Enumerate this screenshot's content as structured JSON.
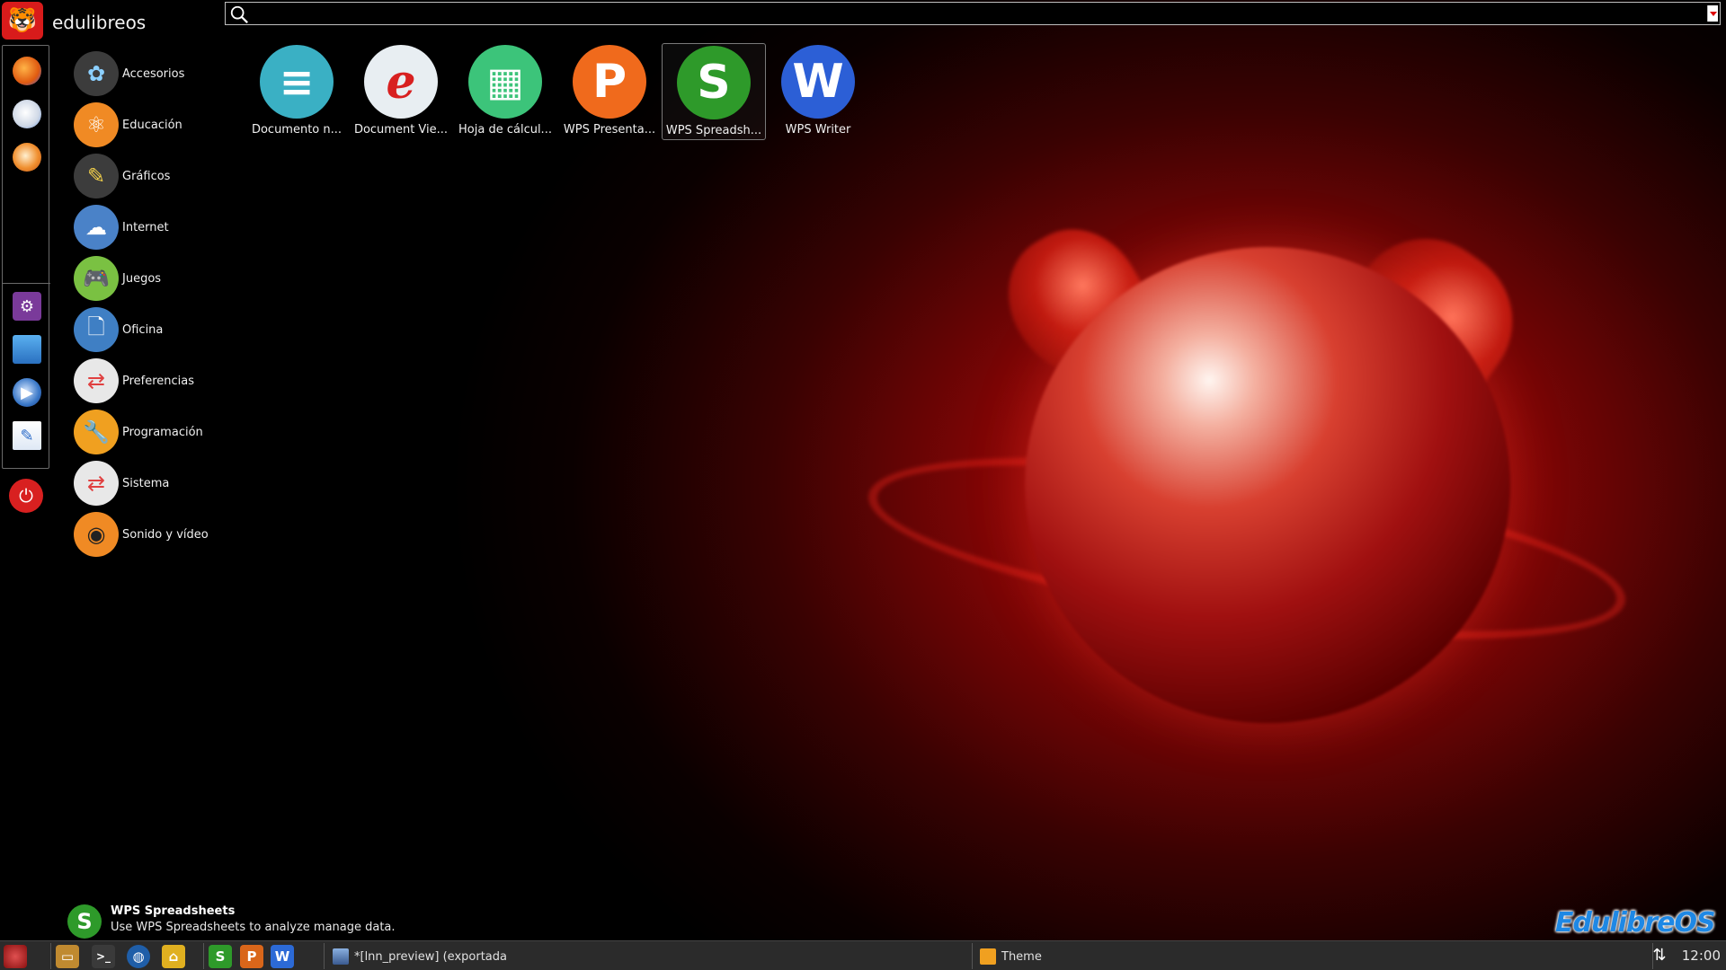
{
  "header": {
    "title": "edulibreos"
  },
  "search": {
    "value": "",
    "placeholder": ""
  },
  "categories": [
    {
      "label": "Accesorios",
      "icon": "accessories-icon",
      "color": "#3c3c3c"
    },
    {
      "label": "Educación",
      "icon": "education-atom-icon",
      "color": "#f08a24"
    },
    {
      "label": "Gráficos",
      "icon": "graphics-icon",
      "color": "#3c3c3c"
    },
    {
      "label": "Internet",
      "icon": "internet-cloud-icon",
      "color": "#4a82c8"
    },
    {
      "label": "Juegos",
      "icon": "games-controller-icon",
      "color": "#7ac142"
    },
    {
      "label": "Oficina",
      "icon": "office-document-icon",
      "color": "#3f7fc4"
    },
    {
      "label": "Preferencias",
      "icon": "preferences-toggle-icon",
      "color": "#e8e8e8"
    },
    {
      "label": "Programación",
      "icon": "programming-wrench-icon",
      "color": "#f0a020"
    },
    {
      "label": "Sistema",
      "icon": "system-toggle-icon",
      "color": "#e8e8e8"
    },
    {
      "label": "Sonido y vídeo",
      "icon": "sound-video-icon",
      "color": "#f08a24"
    }
  ],
  "apps": [
    {
      "label": "Documento n...",
      "icon": "text-document-icon",
      "color": "#3ab0c4",
      "glyph": "≡",
      "selected": false
    },
    {
      "label": "Document Vie...",
      "icon": "document-viewer-icon",
      "color": "#e8eef2",
      "glyph": "e",
      "selected": false
    },
    {
      "label": "Hoja de cálcul...",
      "icon": "spreadsheet-icon",
      "color": "#3cc47a",
      "glyph": "▦",
      "selected": false
    },
    {
      "label": "WPS Presenta...",
      "icon": "wps-presentation-icon",
      "color": "#f06a1c",
      "glyph": "P",
      "selected": false
    },
    {
      "label": "WPS Spreadsh...",
      "icon": "wps-spreadsheets-icon",
      "color": "#2e9a2a",
      "glyph": "S",
      "selected": true
    },
    {
      "label": "WPS Writer",
      "icon": "wps-writer-icon",
      "color": "#2c5fd6",
      "glyph": "W",
      "selected": false
    }
  ],
  "description": {
    "title": "WPS Spreadsheets",
    "text": "Use WPS Spreadsheets to analyze manage data."
  },
  "favorites": [
    {
      "icon": "firefox-icon"
    },
    {
      "icon": "thunderbird-icon"
    },
    {
      "icon": "vlc-icon"
    },
    {
      "icon": "settings-icon"
    },
    {
      "icon": "computer-icon"
    },
    {
      "icon": "media-player-icon"
    },
    {
      "icon": "text-editor-icon"
    }
  ],
  "branding": {
    "logo_text": "EdulibreOS"
  },
  "taskbar": {
    "windows": [
      {
        "label": "*[lnn_preview] (exportada"
      },
      {
        "label": "Theme"
      }
    ],
    "clock": "12:00"
  }
}
